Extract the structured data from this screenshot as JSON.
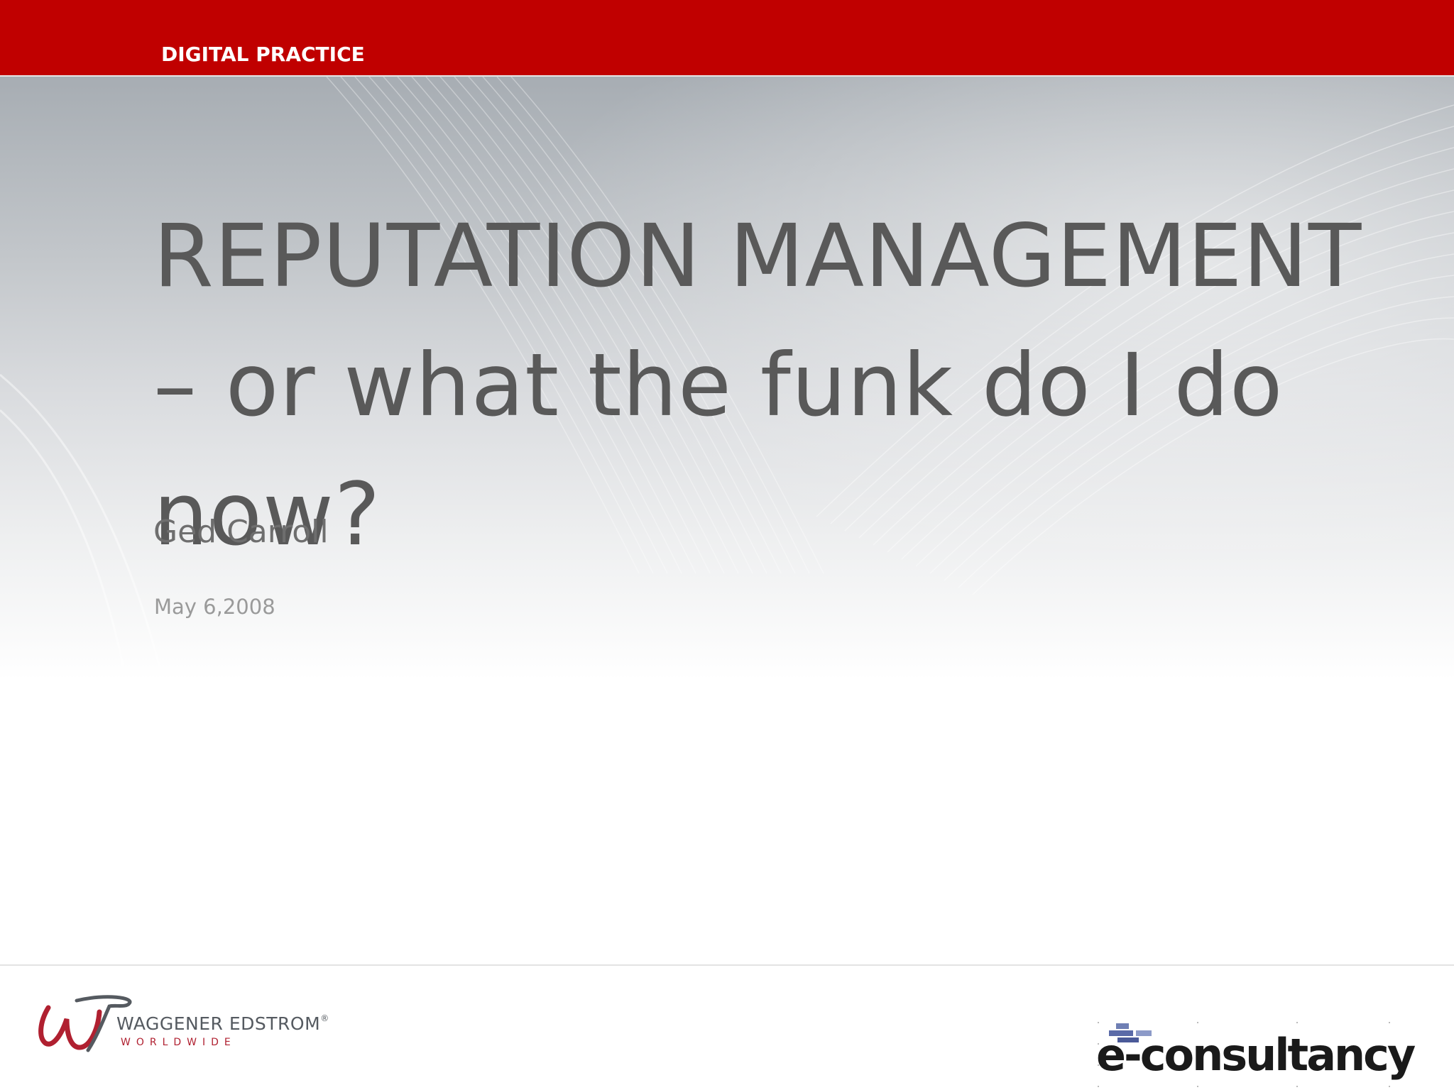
{
  "header": {
    "label": "DIGITAL PRACTICE"
  },
  "slide": {
    "title": "REPUTATION MANAGEMENT – or what the funk do I do now?",
    "author": "Ged Carroll",
    "date": "May 6,2008"
  },
  "footer": {
    "left_logo": {
      "name": "WAGGENER EDSTROM",
      "registered_mark": "®",
      "subtitle": "WORLDWIDE"
    },
    "right_logo": {
      "name": "e-consultancy"
    }
  },
  "colors": {
    "header_red": "#c00000",
    "title_gray": "#595959",
    "logo_red": "#b02030",
    "logo_gray": "#555a60"
  },
  "icons": {
    "left_logo_mark": "waggener-edstrom-w-icon",
    "right_logo_mark": "e-consultancy-blocks-icon"
  }
}
